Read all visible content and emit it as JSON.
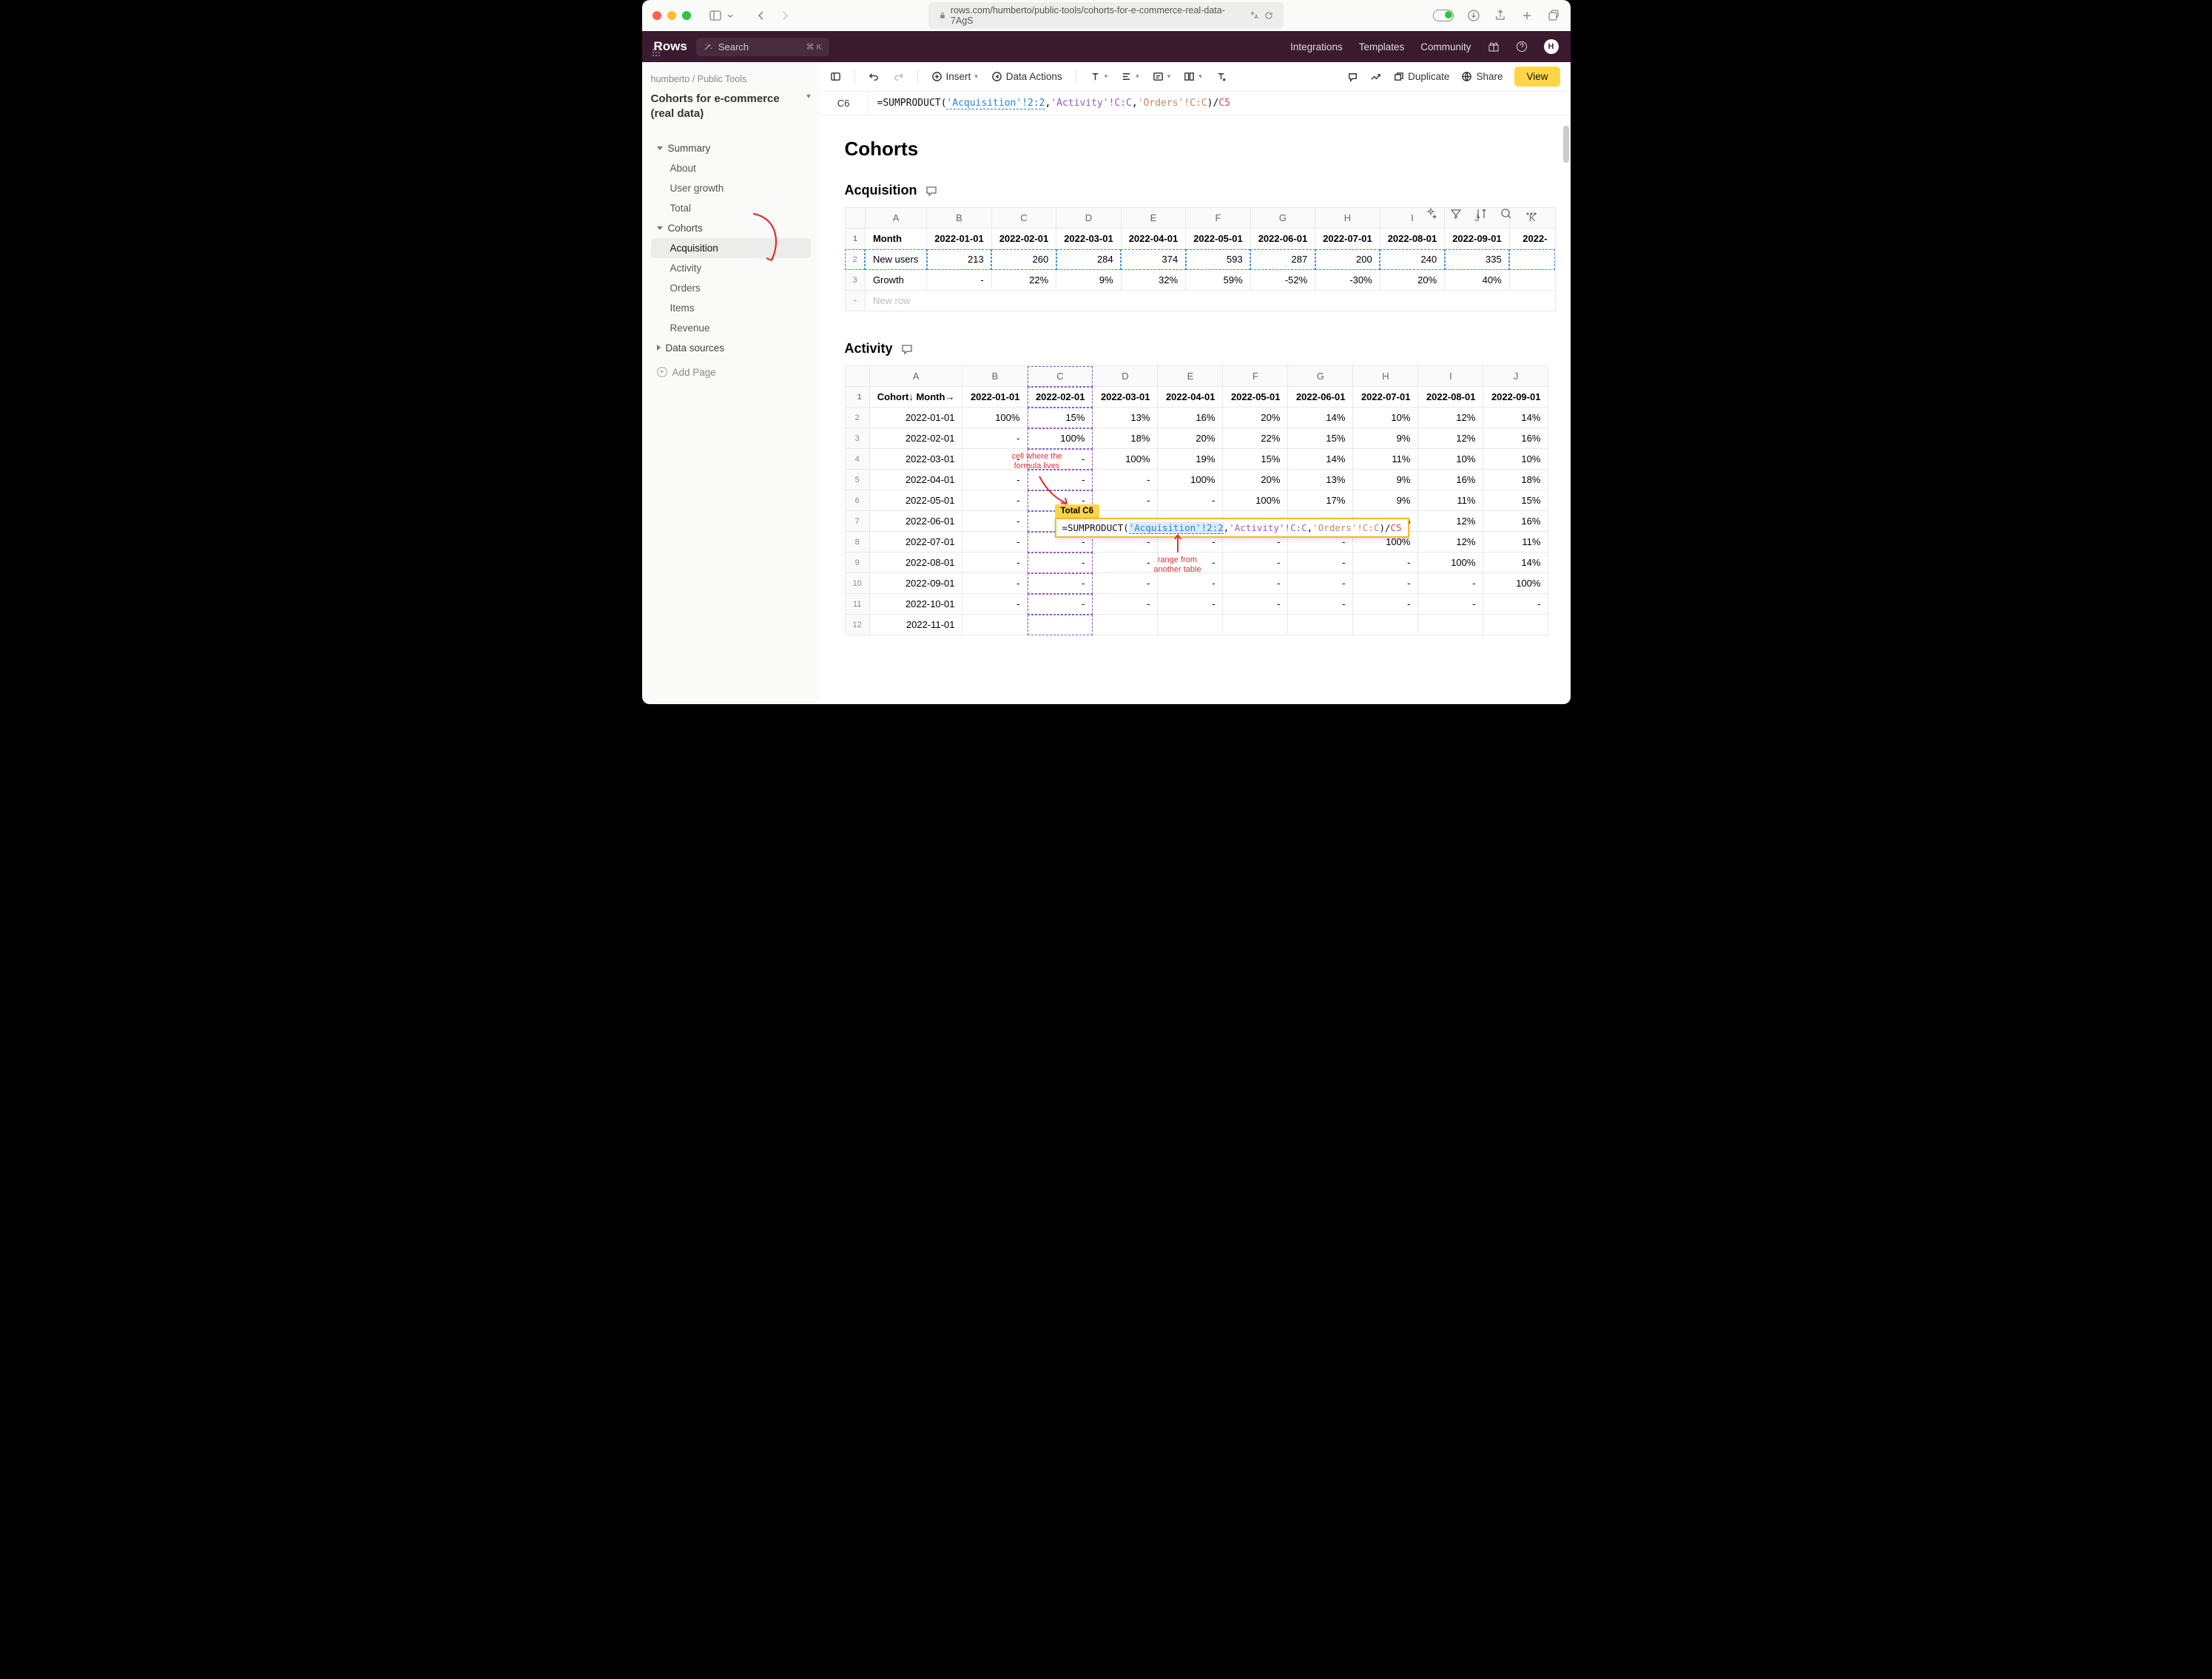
{
  "browser": {
    "url": "rows.com/humberto/public-tools/cohorts-for-e-commerce-real-data-7AgS"
  },
  "app": {
    "logo": "Rows",
    "search_placeholder": "Search",
    "search_kbd": "⌘ K",
    "nav": {
      "integrations": "Integrations",
      "templates": "Templates",
      "community": "Community"
    },
    "avatar_letter": "H"
  },
  "toolbar": {
    "insert": "Insert",
    "data_actions": "Data Actions",
    "duplicate": "Duplicate",
    "share": "Share",
    "view": "View"
  },
  "formula_bar": {
    "cell": "C6",
    "prefix": "=SUMPRODUCT(",
    "range1": "'Acquisition'!2:2",
    "comma1": ",",
    "range2": "'Activity'!C:C",
    "comma2": ",",
    "range3": "'Orders'!C:C",
    "suffix": ")/",
    "range4": "C5"
  },
  "sidebar": {
    "crumb1": "humberto",
    "crumb2": "Public Tools",
    "title": "Cohorts for e-commerce (real data)",
    "items": {
      "summary": "Summary",
      "about": "About",
      "user_growth": "User growth",
      "total": "Total",
      "cohorts": "Cohorts",
      "acquisition": "Acquisition",
      "activity": "Activity",
      "orders": "Orders",
      "items": "Items",
      "revenue": "Revenue",
      "data_sources": "Data sources",
      "add_page": "Add Page"
    }
  },
  "page": {
    "title": "Cohorts",
    "acquisition_title": "Acquisition",
    "activity_title": "Activity"
  },
  "acquisition": {
    "cols": [
      "A",
      "B",
      "C",
      "D",
      "E",
      "F",
      "G",
      "H",
      "I",
      "J",
      "K"
    ],
    "header_label": "Month",
    "months": [
      "2022-01-01",
      "2022-02-01",
      "2022-03-01",
      "2022-04-01",
      "2022-05-01",
      "2022-06-01",
      "2022-07-01",
      "2022-08-01",
      "2022-09-01",
      "2022-"
    ],
    "row2_label": "New users",
    "row2": [
      "213",
      "260",
      "284",
      "374",
      "593",
      "287",
      "200",
      "240",
      "335",
      ""
    ],
    "row3_label": "Growth",
    "row3": [
      "-",
      "22%",
      "9%",
      "32%",
      "59%",
      "-52%",
      "-30%",
      "20%",
      "40%",
      ""
    ],
    "new_row": "New row"
  },
  "activity": {
    "cols": [
      "A",
      "B",
      "C",
      "D",
      "E",
      "F",
      "G",
      "H",
      "I",
      "J"
    ],
    "header_label": "Cohort↓ Month→",
    "months": [
      "2022-01-01",
      "2022-02-01",
      "2022-03-01",
      "2022-04-01",
      "2022-05-01",
      "2022-06-01",
      "2022-07-01",
      "2022-08-01",
      "2022-09-01"
    ],
    "rows": [
      {
        "label": "2022-01-01",
        "cells": [
          "100%",
          "15%",
          "13%",
          "16%",
          "20%",
          "14%",
          "10%",
          "12%",
          "14%"
        ]
      },
      {
        "label": "2022-02-01",
        "cells": [
          "-",
          "100%",
          "18%",
          "20%",
          "22%",
          "15%",
          "9%",
          "12%",
          "16%"
        ]
      },
      {
        "label": "2022-03-01",
        "cells": [
          "-",
          "-",
          "100%",
          "19%",
          "15%",
          "14%",
          "11%",
          "10%",
          "10%"
        ]
      },
      {
        "label": "2022-04-01",
        "cells": [
          "-",
          "-",
          "-",
          "100%",
          "20%",
          "13%",
          "9%",
          "16%",
          "18%"
        ]
      },
      {
        "label": "2022-05-01",
        "cells": [
          "-",
          "-",
          "-",
          "-",
          "100%",
          "17%",
          "9%",
          "11%",
          "15%"
        ]
      },
      {
        "label": "2022-06-01",
        "cells": [
          "-",
          "-",
          "-",
          "-",
          "-",
          "100%",
          "11%",
          "12%",
          "16%"
        ]
      },
      {
        "label": "2022-07-01",
        "cells": [
          "-",
          "-",
          "-",
          "-",
          "-",
          "-",
          "100%",
          "12%",
          "11%"
        ]
      },
      {
        "label": "2022-08-01",
        "cells": [
          "-",
          "-",
          "-",
          "-",
          "-",
          "-",
          "-",
          "100%",
          "14%"
        ]
      },
      {
        "label": "2022-09-01",
        "cells": [
          "-",
          "-",
          "-",
          "-",
          "-",
          "-",
          "-",
          "-",
          "100%"
        ]
      },
      {
        "label": "2022-10-01",
        "cells": [
          "-",
          "-",
          "-",
          "-",
          "-",
          "-",
          "-",
          "-",
          "-"
        ]
      },
      {
        "label": "2022-11-01",
        "cells": [
          "",
          "",
          "",
          "",
          "",
          "",
          "",
          "",
          ""
        ]
      }
    ]
  },
  "annotations": {
    "formula_lives": "cell where the formula lives",
    "range_from": "range from another table",
    "tooltip": "Total C6"
  }
}
